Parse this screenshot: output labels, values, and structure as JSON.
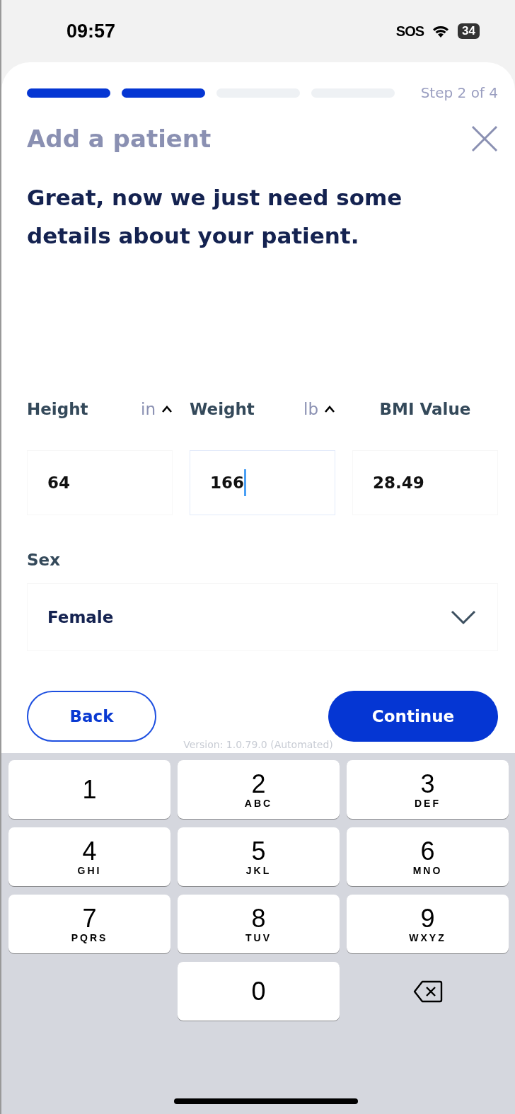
{
  "status_bar": {
    "time": "09:57",
    "sos": "SOS",
    "battery": "34"
  },
  "progress": {
    "segments": [
      {
        "done": true
      },
      {
        "done": true
      },
      {
        "done": false
      },
      {
        "done": false
      }
    ],
    "step": "Step 2 of 4"
  },
  "title": "Add a patient",
  "heading": "Great, now we just need some details about your patient.",
  "measurements": [
    {
      "label": "Height",
      "unit": "in",
      "value": "64",
      "focused": false
    },
    {
      "label": "Weight",
      "unit": "lb",
      "value": "166",
      "focused": true
    },
    {
      "label": "BMI Value",
      "value": "28.49",
      "focused": false
    }
  ],
  "sex": {
    "label": "Sex",
    "value": "Female"
  },
  "buttons": {
    "back": "Back",
    "continue": "Continue"
  },
  "version": "Version: 1.0.79.0 (Automated)",
  "keyboard": [
    {
      "kind": "digit",
      "digit": "1"
    },
    {
      "kind": "digit",
      "digit": "2",
      "letters": "ABC"
    },
    {
      "kind": "digit",
      "digit": "3",
      "letters": "DEF"
    },
    {
      "kind": "digit",
      "digit": "4",
      "letters": "GHI"
    },
    {
      "kind": "digit",
      "digit": "5",
      "letters": "JKL"
    },
    {
      "kind": "digit",
      "digit": "6",
      "letters": "MNO"
    },
    {
      "kind": "digit",
      "digit": "7",
      "letters": "PQRS"
    },
    {
      "kind": "digit",
      "digit": "8",
      "letters": "TUV"
    },
    {
      "kind": "digit",
      "digit": "9",
      "letters": "WXYZ"
    },
    {
      "kind": "blank"
    },
    {
      "kind": "digit",
      "digit": "0"
    },
    {
      "kind": "delete"
    }
  ]
}
